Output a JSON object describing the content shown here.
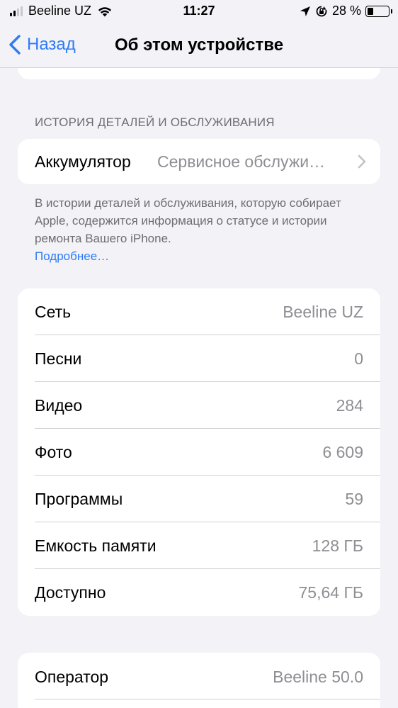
{
  "status_bar": {
    "carrier": "Beeline UZ",
    "time": "11:27",
    "battery_percent": "28 %",
    "battery_level": 0.28,
    "signal_bars": 4,
    "signal_active": 2
  },
  "nav": {
    "back_label": "Назад",
    "title": "Об этом устройстве"
  },
  "history": {
    "header": "ИСТОРИЯ ДЕТАЛЕЙ И ОБСЛУЖИВАНИЯ",
    "battery_label": "Аккумулятор",
    "battery_value": "Сервисное обслужи…",
    "footnote": "В истории деталей и обслуживания, которую собирает Apple, содержится информация о статусе и истории ремонта Вашего iPhone.",
    "more_link": "Подробнее…"
  },
  "info": {
    "rows": [
      {
        "label": "Сеть",
        "value": "Beeline UZ"
      },
      {
        "label": "Песни",
        "value": "0"
      },
      {
        "label": "Видео",
        "value": "284"
      },
      {
        "label": "Фото",
        "value": "6 609"
      },
      {
        "label": "Программы",
        "value": "59"
      },
      {
        "label": "Емкость памяти",
        "value": "128 ГБ"
      },
      {
        "label": "Доступно",
        "value": "75,64 ГБ"
      }
    ]
  },
  "operator": {
    "label": "Оператор",
    "value": "Beeline 50.0"
  },
  "colors": {
    "accent": "#2f7bf5",
    "background": "#f2f2f7",
    "secondary_text": "#8e8e93"
  }
}
